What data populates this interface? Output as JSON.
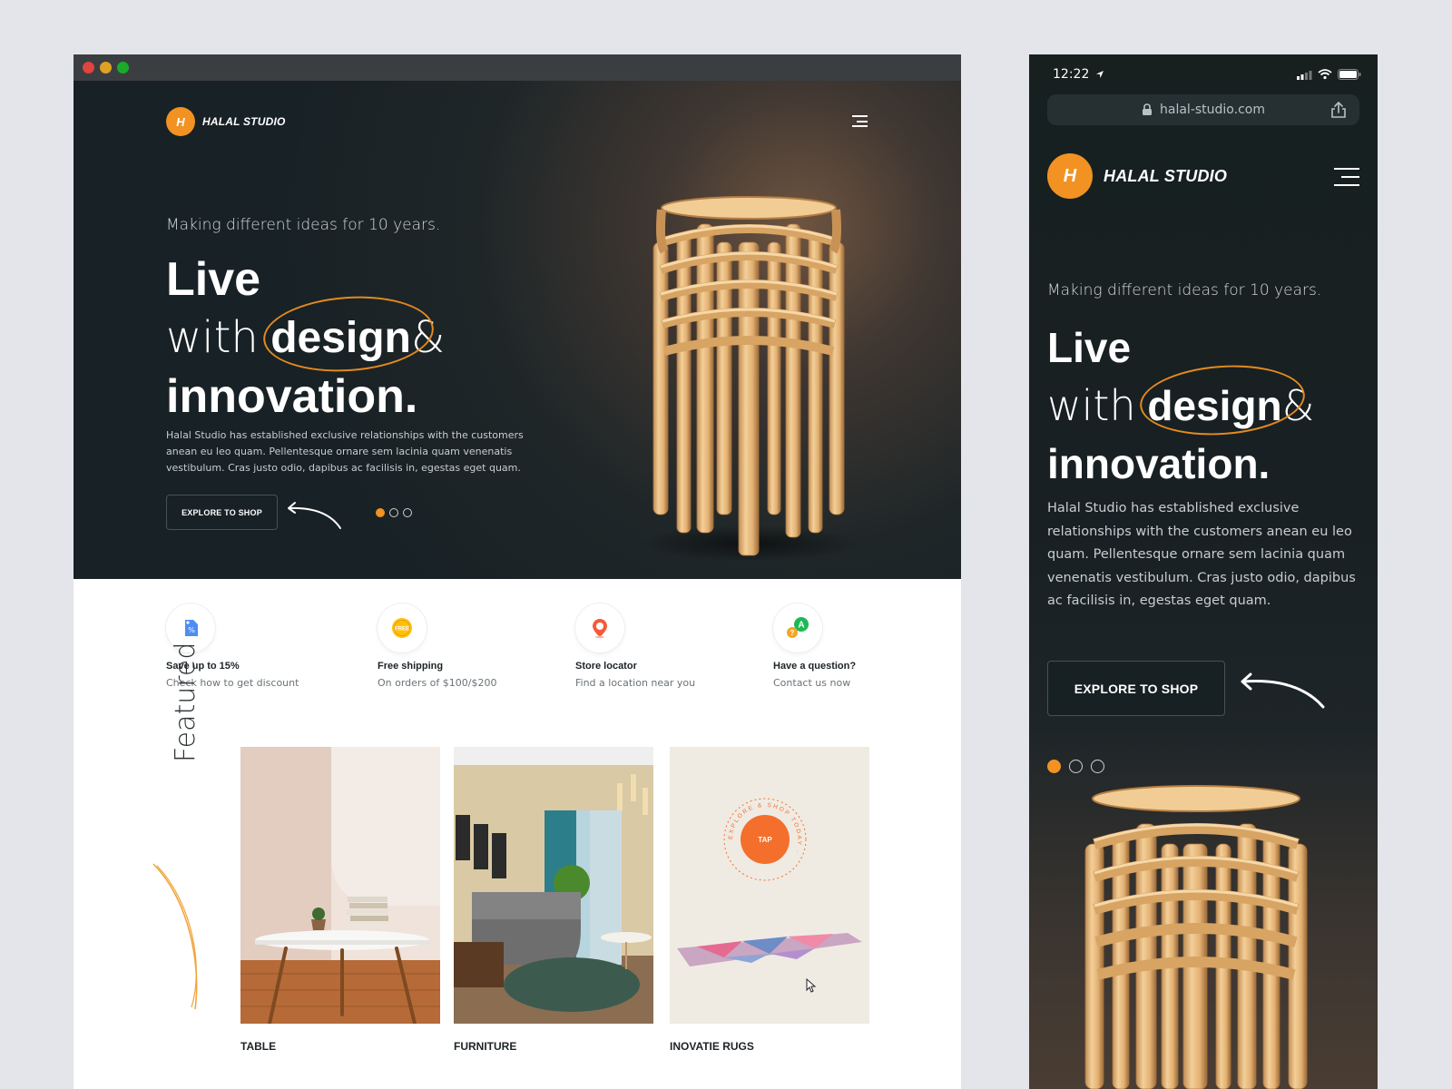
{
  "brand": {
    "name": "HALAL STUDIO",
    "badge": "H"
  },
  "hero": {
    "tagline": "Making different ideas for 10 years.",
    "headline_line1": "Live",
    "headline_with": "with",
    "headline_design": "design",
    "headline_amp": "&",
    "headline_line3": "innovation.",
    "paragraph": "Halal Studio has established exclusive relationships with the customers anean eu leo quam. Pellentesque ornare sem lacinia quam venenatis vestibulum. Cras justo odio, dapibus ac facilisis in, egestas eget quam.",
    "cta_label": "EXPLORE TO SHOP",
    "slides_total": 3,
    "slide_active": 1
  },
  "features": [
    {
      "title": "Save up to 15%",
      "subtitle": "Check how to get discount",
      "icon": "discount-tag-icon"
    },
    {
      "title": "Free shipping",
      "subtitle": "On orders of $100/$200",
      "icon": "free-badge-icon",
      "badge_text": "FREE"
    },
    {
      "title": "Store locator",
      "subtitle": "Find a location near you",
      "icon": "location-pin-icon"
    },
    {
      "title": "Have a question?",
      "subtitle": "Contact us now",
      "icon": "chat-question-icon",
      "badge_text": "A"
    }
  ],
  "featured": {
    "label": "Featured",
    "cards": [
      {
        "label": "TABLE"
      },
      {
        "label": "FURNITURE"
      },
      {
        "label": "INOVATIE RUGS",
        "tap_label": "TAP",
        "ring_text": "EXPLORE & SHOP TODAY ·"
      }
    ]
  },
  "mobile": {
    "status_time": "12:22",
    "url": "halal-studio.com"
  },
  "colors": {
    "accent": "#f29222",
    "hero_bg": "#182125",
    "text_dark": "#1c2326"
  }
}
